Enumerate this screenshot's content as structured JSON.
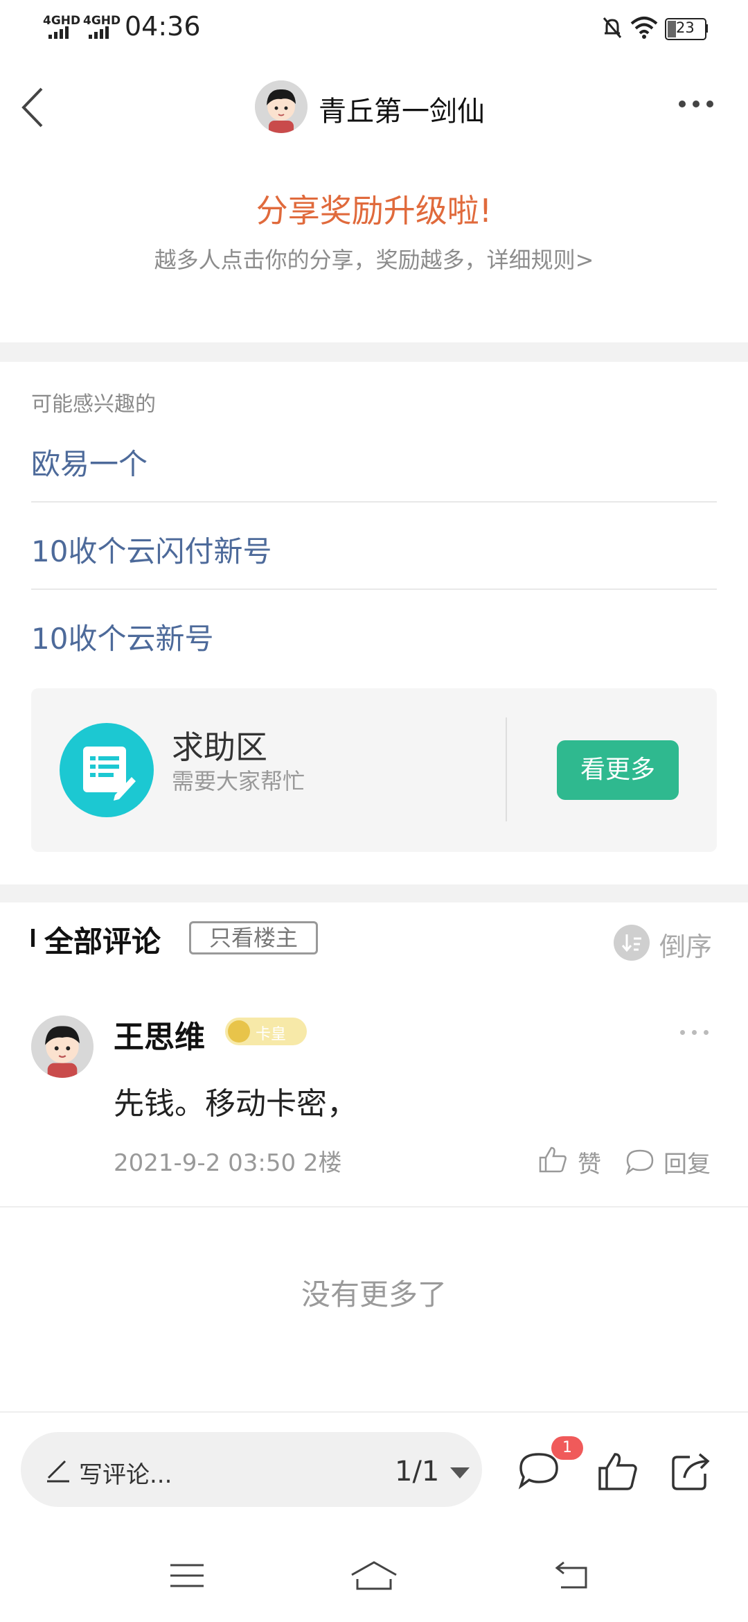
{
  "status_bar": {
    "signal1": "4GHD",
    "signal2": "4GHD",
    "time": "04:36",
    "battery": "23"
  },
  "header": {
    "title": "青丘第一剑仙"
  },
  "promo": {
    "title": "分享奖励升级啦!",
    "subtitle": "越多人点击你的分享，奖励越多，详细规则>"
  },
  "interest": {
    "label": "可能感兴趣的",
    "items": [
      {
        "text": "欧易一个"
      },
      {
        "text": "10收个云闪付新号"
      },
      {
        "text": "10收个云新号"
      }
    ]
  },
  "help_card": {
    "title": "求助区",
    "subtitle": "需要大家帮忙",
    "button": "看更多"
  },
  "comments": {
    "title": "全部评论",
    "owner_only": "只看楼主",
    "sort": "倒序",
    "items": [
      {
        "name": "王思维",
        "badge": "卡皇",
        "text": "先钱。移动卡密，",
        "meta": "2021-9-2 03:50  2楼",
        "like": "赞",
        "reply": "回复"
      }
    ],
    "no_more": "没有更多了"
  },
  "bottom_bar": {
    "write_placeholder": "写评论...",
    "page": "1/1",
    "comment_badge": "1"
  },
  "colors": {
    "accent_orange": "#e06a3c",
    "link_blue": "#4d6a9a",
    "button_green": "#2fb98f",
    "icon_cyan": "#1cc8d2",
    "badge_red": "#f05a5a"
  }
}
